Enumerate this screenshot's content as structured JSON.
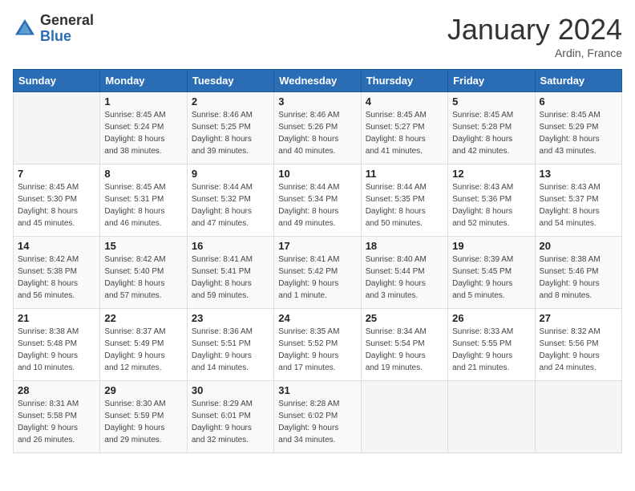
{
  "logo": {
    "general": "General",
    "blue": "Blue"
  },
  "title": "January 2024",
  "location": "Ardin, France",
  "days_header": [
    "Sunday",
    "Monday",
    "Tuesday",
    "Wednesday",
    "Thursday",
    "Friday",
    "Saturday"
  ],
  "weeks": [
    [
      {
        "day": "",
        "sunrise": "",
        "sunset": "",
        "daylight": ""
      },
      {
        "day": "1",
        "sunrise": "Sunrise: 8:45 AM",
        "sunset": "Sunset: 5:24 PM",
        "daylight": "Daylight: 8 hours and 38 minutes."
      },
      {
        "day": "2",
        "sunrise": "Sunrise: 8:46 AM",
        "sunset": "Sunset: 5:25 PM",
        "daylight": "Daylight: 8 hours and 39 minutes."
      },
      {
        "day": "3",
        "sunrise": "Sunrise: 8:46 AM",
        "sunset": "Sunset: 5:26 PM",
        "daylight": "Daylight: 8 hours and 40 minutes."
      },
      {
        "day": "4",
        "sunrise": "Sunrise: 8:45 AM",
        "sunset": "Sunset: 5:27 PM",
        "daylight": "Daylight: 8 hours and 41 minutes."
      },
      {
        "day": "5",
        "sunrise": "Sunrise: 8:45 AM",
        "sunset": "Sunset: 5:28 PM",
        "daylight": "Daylight: 8 hours and 42 minutes."
      },
      {
        "day": "6",
        "sunrise": "Sunrise: 8:45 AM",
        "sunset": "Sunset: 5:29 PM",
        "daylight": "Daylight: 8 hours and 43 minutes."
      }
    ],
    [
      {
        "day": "7",
        "sunrise": "Sunrise: 8:45 AM",
        "sunset": "Sunset: 5:30 PM",
        "daylight": "Daylight: 8 hours and 45 minutes."
      },
      {
        "day": "8",
        "sunrise": "Sunrise: 8:45 AM",
        "sunset": "Sunset: 5:31 PM",
        "daylight": "Daylight: 8 hours and 46 minutes."
      },
      {
        "day": "9",
        "sunrise": "Sunrise: 8:44 AM",
        "sunset": "Sunset: 5:32 PM",
        "daylight": "Daylight: 8 hours and 47 minutes."
      },
      {
        "day": "10",
        "sunrise": "Sunrise: 8:44 AM",
        "sunset": "Sunset: 5:34 PM",
        "daylight": "Daylight: 8 hours and 49 minutes."
      },
      {
        "day": "11",
        "sunrise": "Sunrise: 8:44 AM",
        "sunset": "Sunset: 5:35 PM",
        "daylight": "Daylight: 8 hours and 50 minutes."
      },
      {
        "day": "12",
        "sunrise": "Sunrise: 8:43 AM",
        "sunset": "Sunset: 5:36 PM",
        "daylight": "Daylight: 8 hours and 52 minutes."
      },
      {
        "day": "13",
        "sunrise": "Sunrise: 8:43 AM",
        "sunset": "Sunset: 5:37 PM",
        "daylight": "Daylight: 8 hours and 54 minutes."
      }
    ],
    [
      {
        "day": "14",
        "sunrise": "Sunrise: 8:42 AM",
        "sunset": "Sunset: 5:38 PM",
        "daylight": "Daylight: 8 hours and 56 minutes."
      },
      {
        "day": "15",
        "sunrise": "Sunrise: 8:42 AM",
        "sunset": "Sunset: 5:40 PM",
        "daylight": "Daylight: 8 hours and 57 minutes."
      },
      {
        "day": "16",
        "sunrise": "Sunrise: 8:41 AM",
        "sunset": "Sunset: 5:41 PM",
        "daylight": "Daylight: 8 hours and 59 minutes."
      },
      {
        "day": "17",
        "sunrise": "Sunrise: 8:41 AM",
        "sunset": "Sunset: 5:42 PM",
        "daylight": "Daylight: 9 hours and 1 minute."
      },
      {
        "day": "18",
        "sunrise": "Sunrise: 8:40 AM",
        "sunset": "Sunset: 5:44 PM",
        "daylight": "Daylight: 9 hours and 3 minutes."
      },
      {
        "day": "19",
        "sunrise": "Sunrise: 8:39 AM",
        "sunset": "Sunset: 5:45 PM",
        "daylight": "Daylight: 9 hours and 5 minutes."
      },
      {
        "day": "20",
        "sunrise": "Sunrise: 8:38 AM",
        "sunset": "Sunset: 5:46 PM",
        "daylight": "Daylight: 9 hours and 8 minutes."
      }
    ],
    [
      {
        "day": "21",
        "sunrise": "Sunrise: 8:38 AM",
        "sunset": "Sunset: 5:48 PM",
        "daylight": "Daylight: 9 hours and 10 minutes."
      },
      {
        "day": "22",
        "sunrise": "Sunrise: 8:37 AM",
        "sunset": "Sunset: 5:49 PM",
        "daylight": "Daylight: 9 hours and 12 minutes."
      },
      {
        "day": "23",
        "sunrise": "Sunrise: 8:36 AM",
        "sunset": "Sunset: 5:51 PM",
        "daylight": "Daylight: 9 hours and 14 minutes."
      },
      {
        "day": "24",
        "sunrise": "Sunrise: 8:35 AM",
        "sunset": "Sunset: 5:52 PM",
        "daylight": "Daylight: 9 hours and 17 minutes."
      },
      {
        "day": "25",
        "sunrise": "Sunrise: 8:34 AM",
        "sunset": "Sunset: 5:54 PM",
        "daylight": "Daylight: 9 hours and 19 minutes."
      },
      {
        "day": "26",
        "sunrise": "Sunrise: 8:33 AM",
        "sunset": "Sunset: 5:55 PM",
        "daylight": "Daylight: 9 hours and 21 minutes."
      },
      {
        "day": "27",
        "sunrise": "Sunrise: 8:32 AM",
        "sunset": "Sunset: 5:56 PM",
        "daylight": "Daylight: 9 hours and 24 minutes."
      }
    ],
    [
      {
        "day": "28",
        "sunrise": "Sunrise: 8:31 AM",
        "sunset": "Sunset: 5:58 PM",
        "daylight": "Daylight: 9 hours and 26 minutes."
      },
      {
        "day": "29",
        "sunrise": "Sunrise: 8:30 AM",
        "sunset": "Sunset: 5:59 PM",
        "daylight": "Daylight: 9 hours and 29 minutes."
      },
      {
        "day": "30",
        "sunrise": "Sunrise: 8:29 AM",
        "sunset": "Sunset: 6:01 PM",
        "daylight": "Daylight: 9 hours and 32 minutes."
      },
      {
        "day": "31",
        "sunrise": "Sunrise: 8:28 AM",
        "sunset": "Sunset: 6:02 PM",
        "daylight": "Daylight: 9 hours and 34 minutes."
      },
      {
        "day": "",
        "sunrise": "",
        "sunset": "",
        "daylight": ""
      },
      {
        "day": "",
        "sunrise": "",
        "sunset": "",
        "daylight": ""
      },
      {
        "day": "",
        "sunrise": "",
        "sunset": "",
        "daylight": ""
      }
    ]
  ]
}
